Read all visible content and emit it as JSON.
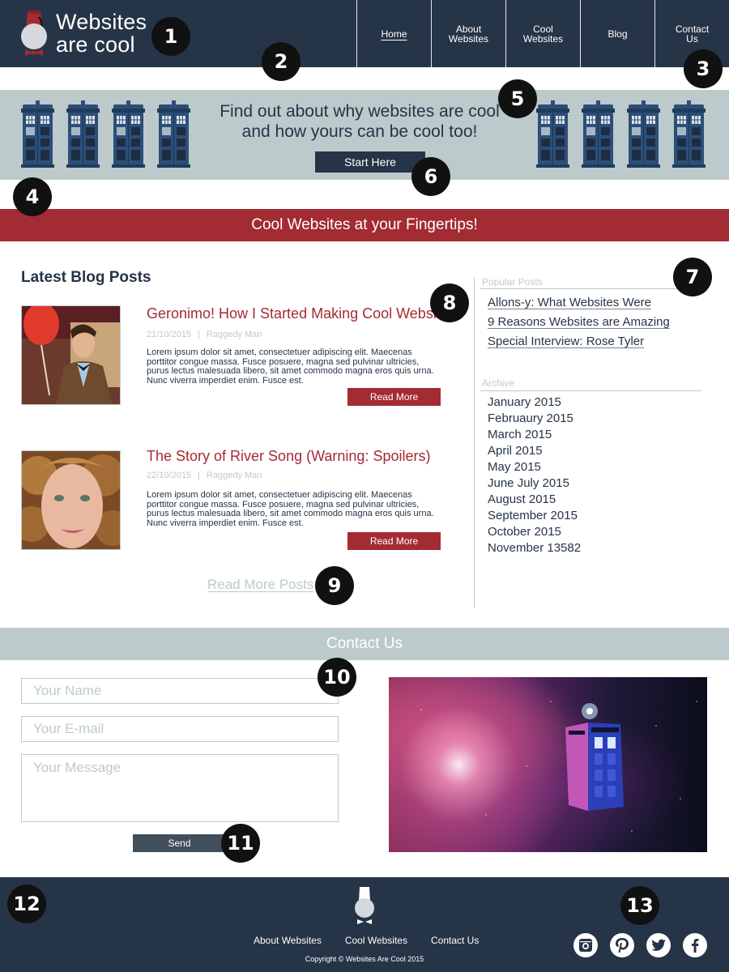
{
  "header": {
    "logo_line1": "Websites",
    "logo_line2": "are cool",
    "nav": [
      {
        "label_line1": "Home",
        "label_line2": "",
        "active": true
      },
      {
        "label_line1": "About",
        "label_line2": "Websites",
        "active": false
      },
      {
        "label_line1": "Cool",
        "label_line2": "Websites",
        "active": false
      },
      {
        "label_line1": "Blog",
        "label_line2": "",
        "active": false
      },
      {
        "label_line1": "Contact",
        "label_line2": "Us",
        "active": false
      }
    ]
  },
  "hero": {
    "line1": "Find out about why websites are cool",
    "line2": "and how yours can be cool too!",
    "cta_label": "Start Here",
    "icon": "tardis-icon"
  },
  "tagline": "Cool Websites at your Fingertips!",
  "blog": {
    "heading": "Latest Blog Posts",
    "posts": [
      {
        "title": "Geronimo! How I Started Making Cool Websites",
        "date": "21/10/2015",
        "author": "Raggedy Man",
        "body": "Lorem ipsum dolor sit amet, consectetuer adipiscing elit. Maecenas porttitor congue massa. Fusce posuere, magna sed pulvinar ultricies, purus lectus malesuada libero, sit amet commodo magna eros quis urna. Nunc viverra imperdiet enim. Fusce est.",
        "read_more": "Read More"
      },
      {
        "title": "The Story of River Song (Warning: Spoilers)",
        "date": "22/10/2015",
        "author": "Raggedy Man",
        "body": "Lorem ipsum dolor sit amet, consectetuer adipiscing elit. Maecenas porttitor congue massa. Fusce posuere, magna sed pulvinar ultricies, purus lectus malesuada libero, sit amet commodo magna eros quis urna. Nunc viverra imperdiet enim. Fusce est.",
        "read_more": "Read More"
      }
    ],
    "more_posts": "Read More Posts",
    "separator": "|"
  },
  "sidebar": {
    "popular_label": "Popular Posts",
    "popular": [
      "Allons-y: What Websites Were",
      "9 Reasons Websites are Amazing",
      "Special Interview: Rose Tyler"
    ],
    "archive_label": "Archive",
    "archive": [
      "January 2015",
      "Februaury 2015",
      "March 2015",
      "April 2015",
      "May 2015",
      "June July 2015",
      "August 2015",
      "September 2015",
      "October 2015",
      "November 13582"
    ]
  },
  "contact": {
    "heading": "Contact Us",
    "name_placeholder": "Your Name",
    "email_placeholder": "Your E-mail",
    "message_placeholder": "Your Message",
    "send_label": "Send"
  },
  "footer": {
    "links": [
      "About Websites",
      "Cool Websites",
      "Contact Us"
    ],
    "copyright": "Copyright © Websites Are Cool 2015",
    "socials": [
      "instagram-icon",
      "pinterest-icon",
      "twitter-icon",
      "facebook-icon"
    ]
  },
  "markers": [
    "1",
    "2",
    "3",
    "4",
    "5",
    "6",
    "7",
    "8",
    "9",
    "10",
    "11",
    "12",
    "13"
  ],
  "colors": {
    "navy": "#263447",
    "crimson": "#a32b33",
    "slate": "#bdcacb",
    "tardis_blue": "#2c4f78"
  }
}
